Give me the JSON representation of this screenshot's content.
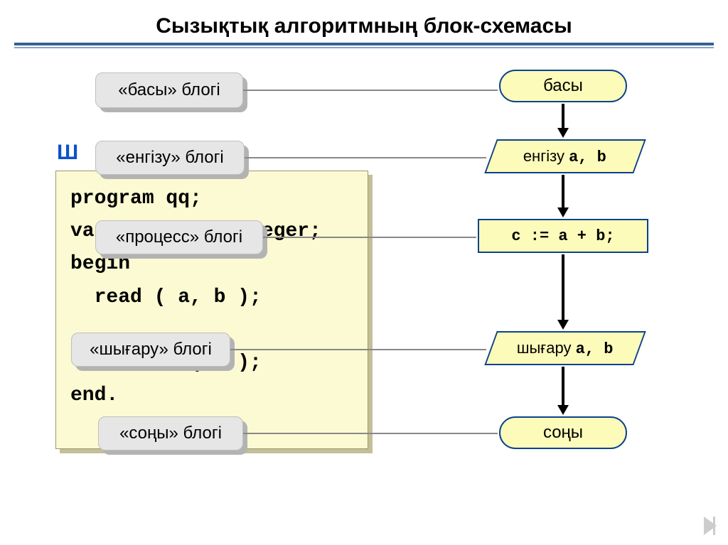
{
  "title": "Сызықтық алгоритмның блок-схемасы",
  "peek": "Ш",
  "code": "program qq;\nvar a, b, c: integer;\nbegin\n  read ( a, b );\n\n  writeln ( c );\nend.",
  "labels": {
    "start": "«басы» блогі",
    "input": "«енгізу» блогі",
    "process": "«процесс» блогі",
    "output": "«шығару» блогі",
    "end": "«соңы» блогі"
  },
  "flowchart": {
    "start": "басы",
    "input_text": "енгізу ",
    "input_vars": "a, b",
    "process": "c := a + b;",
    "output_text": "шығару ",
    "output_vars": "a, b",
    "end": "соңы"
  }
}
